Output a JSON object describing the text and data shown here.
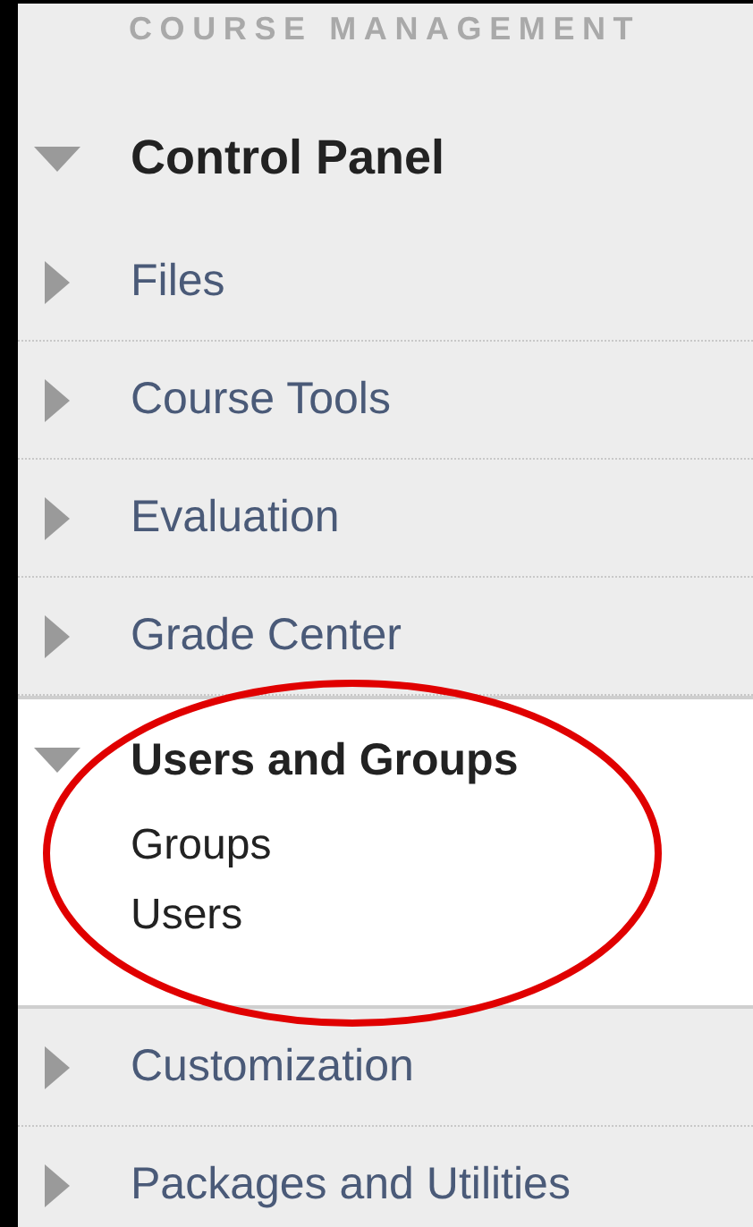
{
  "header": "COURSE MANAGEMENT",
  "panel": {
    "title": "Control Panel",
    "expanded": true,
    "items": [
      {
        "label": "Files",
        "expanded": false
      },
      {
        "label": "Course Tools",
        "expanded": false
      },
      {
        "label": "Evaluation",
        "expanded": false
      },
      {
        "label": "Grade Center",
        "expanded": false
      },
      {
        "label": "Users and Groups",
        "expanded": true,
        "children": [
          {
            "label": "Groups"
          },
          {
            "label": "Users"
          }
        ]
      },
      {
        "label": "Customization",
        "expanded": false
      },
      {
        "label": "Packages and Utilities",
        "expanded": false
      }
    ]
  }
}
